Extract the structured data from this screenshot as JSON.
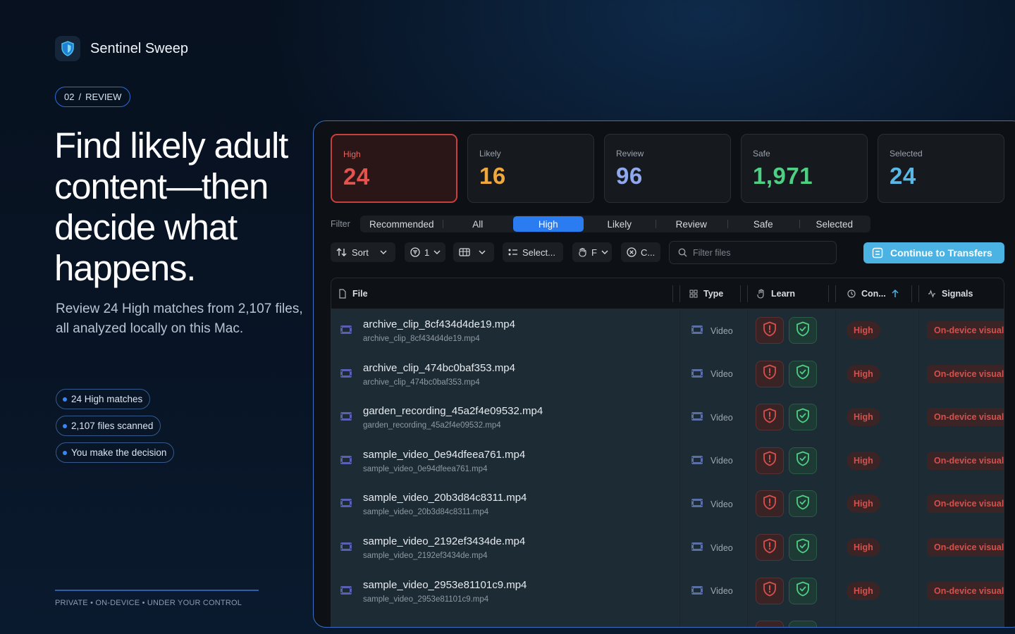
{
  "brand": {
    "name": "Sentinel Sweep"
  },
  "step": {
    "number": "02",
    "separator": "/",
    "label": "REVIEW"
  },
  "hero": {
    "headline": "Find likely adult content—then decide what happens.",
    "subtext": "Review 24 High matches from 2,107 files, all analyzed locally on this Mac."
  },
  "chips": [
    "24 High matches",
    "2,107 files scanned",
    "You make the decision"
  ],
  "footer": "PRIVATE • ON-DEVICE • UNDER YOUR CONTROL",
  "stats": [
    {
      "label": "High",
      "value": "24",
      "color": "#e4544e"
    },
    {
      "label": "Likely",
      "value": "16",
      "color": "#f0a83c"
    },
    {
      "label": "Review",
      "value": "96",
      "color": "#8fa8ee"
    },
    {
      "label": "Safe",
      "value": "1,971",
      "color": "#4fcf83"
    },
    {
      "label": "Selected",
      "value": "24",
      "color": "#5ab8e6"
    }
  ],
  "filter": {
    "label": "Filter",
    "options": [
      "Recommended",
      "All",
      "High",
      "Likely",
      "Review",
      "Safe",
      "Selected"
    ],
    "active": "High"
  },
  "toolbar": {
    "sort_label": "Sort",
    "group_label": "1",
    "select_label": "Select...",
    "column_label": "F",
    "clear_label": "C...",
    "search_placeholder": "Filter files",
    "continue_label": "Continue to Transfers"
  },
  "table": {
    "columns": {
      "file": "File",
      "type": "Type",
      "learn": "Learn",
      "confidence": "Con...",
      "signals": "Signals"
    },
    "rows": [
      {
        "name": "archive_clip_8cf434d4de19.mp4",
        "sub": "archive_clip_8cf434d4de19.mp4",
        "type": "Video",
        "confidence": "High",
        "signal": "On-device visual"
      },
      {
        "name": "archive_clip_474bc0baf353.mp4",
        "sub": "archive_clip_474bc0baf353.mp4",
        "type": "Video",
        "confidence": "High",
        "signal": "On-device visual"
      },
      {
        "name": "garden_recording_45a2f4e09532.mp4",
        "sub": "garden_recording_45a2f4e09532.mp4",
        "type": "Video",
        "confidence": "High",
        "signal": "On-device visual"
      },
      {
        "name": "sample_video_0e94dfeea761.mp4",
        "sub": "sample_video_0e94dfeea761.mp4",
        "type": "Video",
        "confidence": "High",
        "signal": "On-device visual"
      },
      {
        "name": "sample_video_20b3d84c8311.mp4",
        "sub": "sample_video_20b3d84c8311.mp4",
        "type": "Video",
        "confidence": "High",
        "signal": "On-device visual"
      },
      {
        "name": "sample_video_2192ef3434de.mp4",
        "sub": "sample_video_2192ef3434de.mp4",
        "type": "Video",
        "confidence": "High",
        "signal": "On-device visual"
      },
      {
        "name": "sample_video_2953e81101c9.mp4",
        "sub": "sample_video_2953e81101c9.mp4",
        "type": "Video",
        "confidence": "High",
        "signal": "On-device visual"
      }
    ]
  }
}
